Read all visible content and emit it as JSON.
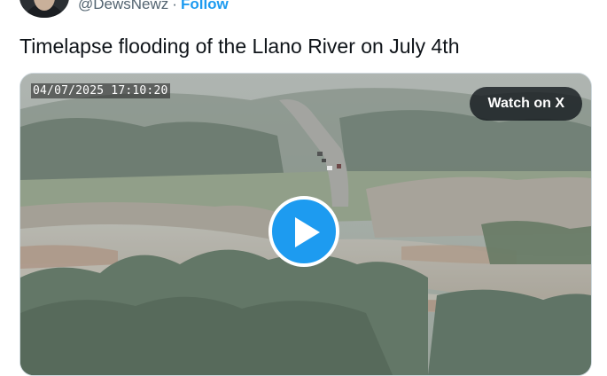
{
  "author": {
    "handle": "@DewsNewz",
    "separator": "·",
    "follow_label": "Follow",
    "avatar_icon": "profile-avatar-icon"
  },
  "tweet": {
    "text": "Timelapse flooding of the Llano River on July 4th"
  },
  "media": {
    "timestamp": "04/07/2025 17:10:20",
    "watch_label": "Watch on X",
    "play_icon": "play-icon",
    "play_color": "#1d9bf0"
  },
  "colors": {
    "link": "#1d9bf0",
    "secondary_text": "#536471",
    "primary_text": "#0f1419"
  }
}
